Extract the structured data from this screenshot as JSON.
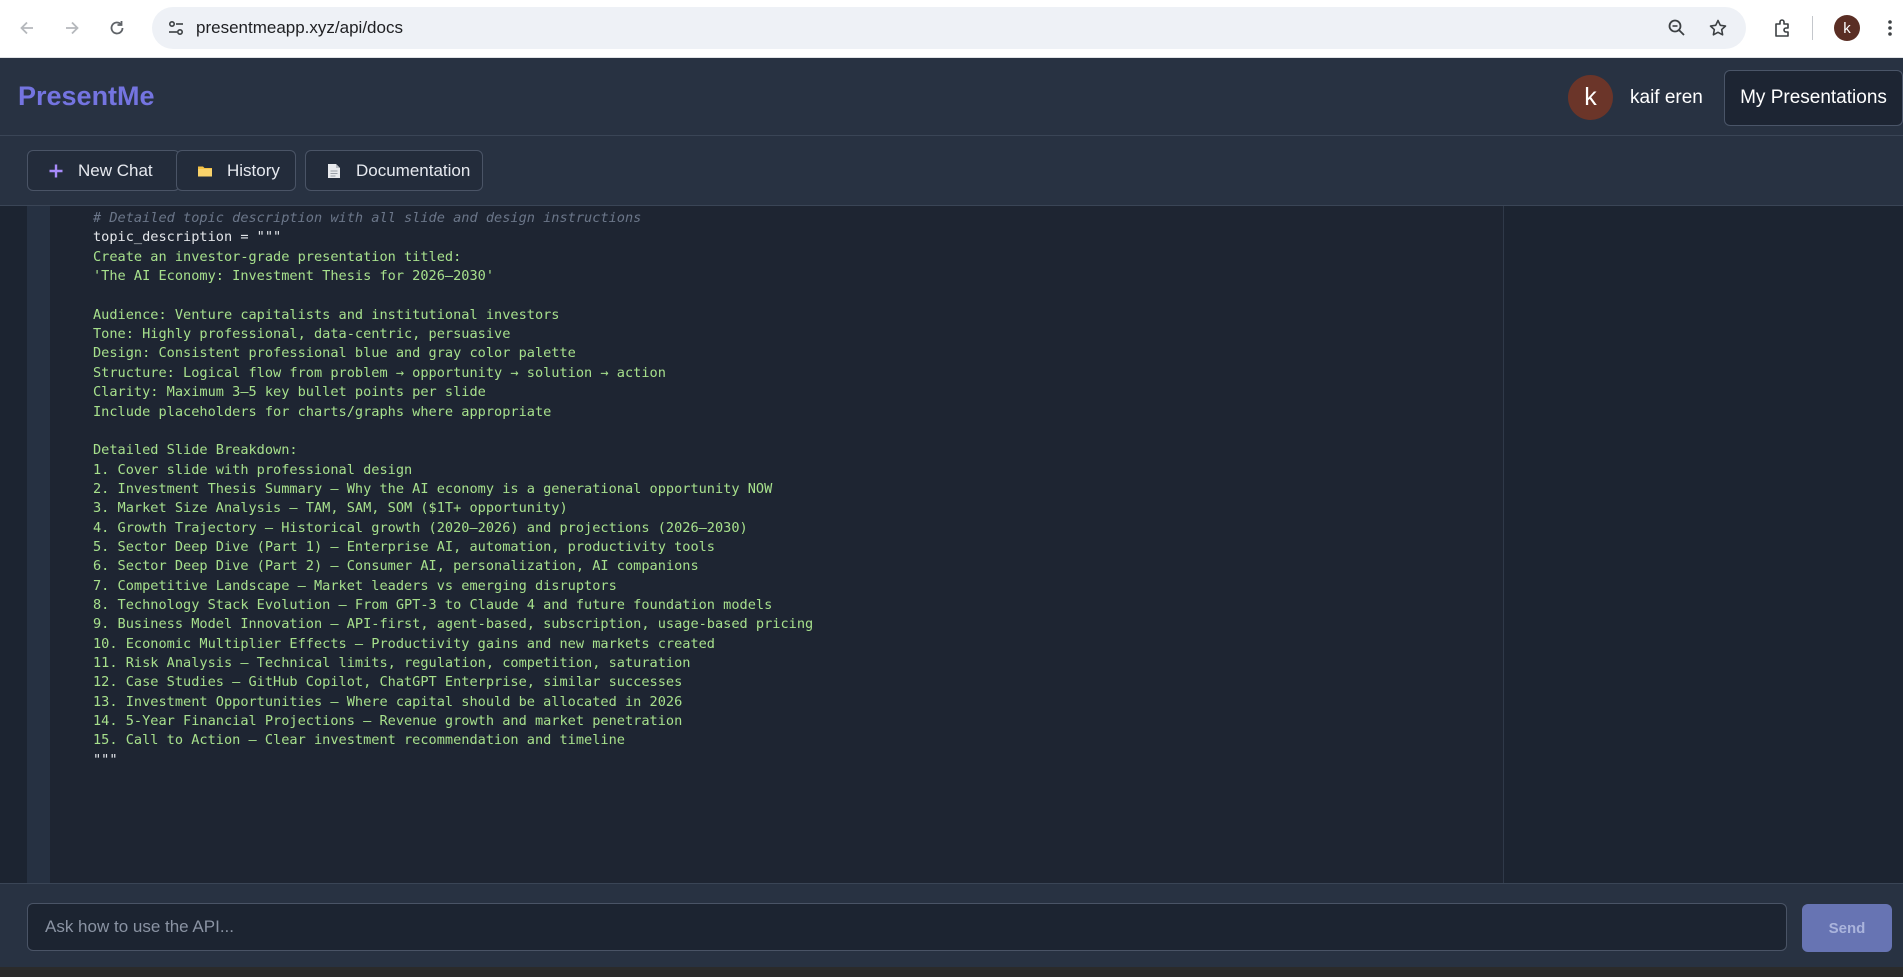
{
  "browser": {
    "url": "presentmeapp.xyz/api/docs",
    "profile_initial": "k"
  },
  "header": {
    "logo": "PresentMe",
    "avatar_initial": "k",
    "username": "kaif eren",
    "my_presentations_label": "My Presentations"
  },
  "toolbar": {
    "new_chat_label": "New Chat",
    "history_label": "History",
    "documentation_label": "Documentation"
  },
  "code": {
    "lines": [
      {
        "text": "# Detailed topic description with all slide and design instructions",
        "kind": "comment"
      },
      {
        "text": "topic_description = \"\"\"",
        "kind": "plain"
      },
      {
        "text": "Create an investor-grade presentation titled:",
        "kind": "string"
      },
      {
        "text": "'The AI Economy: Investment Thesis for 2026–2030'",
        "kind": "string"
      },
      {
        "text": "",
        "kind": "string"
      },
      {
        "text": "Audience: Venture capitalists and institutional investors",
        "kind": "string"
      },
      {
        "text": "Tone: Highly professional, data-centric, persuasive",
        "kind": "string"
      },
      {
        "text": "Design: Consistent professional blue and gray color palette",
        "kind": "string"
      },
      {
        "text": "Structure: Logical flow from problem → opportunity → solution → action",
        "kind": "string"
      },
      {
        "text": "Clarity: Maximum 3–5 key bullet points per slide",
        "kind": "string"
      },
      {
        "text": "Include placeholders for charts/graphs where appropriate",
        "kind": "string"
      },
      {
        "text": "",
        "kind": "string"
      },
      {
        "text": "Detailed Slide Breakdown:",
        "kind": "string"
      },
      {
        "text": "1. Cover slide with professional design",
        "kind": "string"
      },
      {
        "text": "2. Investment Thesis Summary – Why the AI economy is a generational opportunity NOW",
        "kind": "string"
      },
      {
        "text": "3. Market Size Analysis – TAM, SAM, SOM ($1T+ opportunity)",
        "kind": "string"
      },
      {
        "text": "4. Growth Trajectory – Historical growth (2020–2026) and projections (2026–2030)",
        "kind": "string"
      },
      {
        "text": "5. Sector Deep Dive (Part 1) – Enterprise AI, automation, productivity tools",
        "kind": "string"
      },
      {
        "text": "6. Sector Deep Dive (Part 2) – Consumer AI, personalization, AI companions",
        "kind": "string"
      },
      {
        "text": "7. Competitive Landscape – Market leaders vs emerging disruptors",
        "kind": "string"
      },
      {
        "text": "8. Technology Stack Evolution – From GPT-3 to Claude 4 and future foundation models",
        "kind": "string"
      },
      {
        "text": "9. Business Model Innovation – API-first, agent-based, subscription, usage-based pricing",
        "kind": "string"
      },
      {
        "text": "10. Economic Multiplier Effects – Productivity gains and new markets created",
        "kind": "string"
      },
      {
        "text": "11. Risk Analysis – Technical limits, regulation, competition, saturation",
        "kind": "string"
      },
      {
        "text": "12. Case Studies – GitHub Copilot, ChatGPT Enterprise, similar successes",
        "kind": "string"
      },
      {
        "text": "13. Investment Opportunities – Where capital should be allocated in 2026",
        "kind": "string"
      },
      {
        "text": "14. 5-Year Financial Projections – Revenue growth and market penetration",
        "kind": "string"
      },
      {
        "text": "15. Call to Action – Clear investment recommendation and timeline",
        "kind": "string"
      },
      {
        "text": "\"\"\"",
        "kind": "plain"
      }
    ]
  },
  "chat": {
    "placeholder": "Ask how to use the API...",
    "send_label": "Send"
  },
  "colors": {
    "logo": "#7474e0",
    "code_string": "#a7e08c",
    "code_comment": "#6b7689",
    "send_button": "#6774b3"
  }
}
